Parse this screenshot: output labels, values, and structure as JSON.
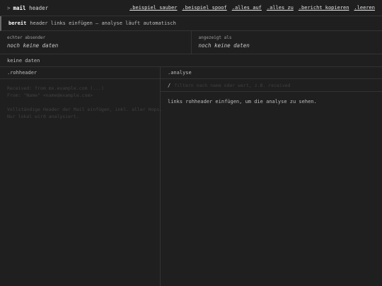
{
  "header": {
    "prompt": ">",
    "brand_bold": "mail",
    "brand_rest": "header",
    "nav": [
      {
        "label": ".beispiel sauber"
      },
      {
        "label": ".beispiel spoof"
      },
      {
        "label": ".alles auf"
      },
      {
        "label": ".alles zu"
      },
      {
        "label": ".bericht kopieren"
      },
      {
        "label": ".leeren"
      }
    ]
  },
  "status": {
    "badge": "bereit",
    "text": "header links einfügen — analyse läuft automatisch"
  },
  "senders": {
    "real": {
      "label": "echter absender",
      "value": "noch keine daten"
    },
    "shown": {
      "label": "angezeigt als",
      "value": "noch keine daten"
    }
  },
  "info": "keine daten",
  "left_panel": {
    "title": ".rohheader",
    "placeholder_lines": [
      "Received: from mx.example.com (...)",
      "From: \"Name\" <name@example.com>",
      "",
      "Vollständige Header der Mail einfügen, inkl. aller Hops.",
      "Nur lokal wird analysiert."
    ]
  },
  "right_panel": {
    "title": ".analyse",
    "search_icon": "/",
    "search_placeholder": "filtern nach name oder wert, z.B. received",
    "hint": "links rohheader einfügen, um die analyse zu sehen."
  }
}
